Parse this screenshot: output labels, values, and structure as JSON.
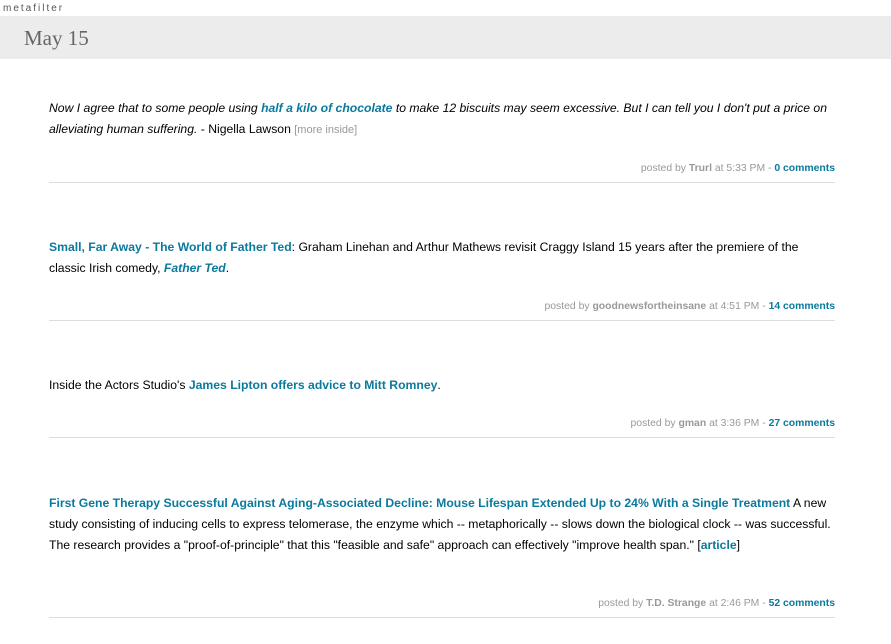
{
  "site": {
    "logo": "metafilter"
  },
  "date_header": "May 15",
  "posts": [
    {
      "text_before": "Now I agree that to some people using ",
      "link": "half a kilo of chocolate",
      "text_after": " to make 12 biscuits may seem excessive. But I can tell you I don't put a price on alleviating human suffering.",
      "attribution": " - Nigella Lawson ",
      "more_inside": "[more inside]",
      "posted_by_label": "posted by",
      "user": "Trurl",
      "time": "at 5:33 PM -",
      "comments": "0 comments"
    },
    {
      "link": "Small, Far Away - The World of Father Ted",
      "text_mid": ": Graham Linehan and Arthur Mathews revisit Craggy Island 15 years after the premiere of the classic Irish comedy, ",
      "link2": "Father Ted",
      "text_end": ".",
      "posted_by_label": "posted by",
      "user": "goodnewsfortheinsane",
      "time": "at 4:51 PM -",
      "comments": "14 comments"
    },
    {
      "text_before": "Inside the Actors Studio's ",
      "link": "James Lipton offers advice to Mitt Romney",
      "text_after": ".",
      "posted_by_label": "posted by",
      "user": "gman",
      "time": "at 3:36 PM -",
      "comments": "27 comments"
    },
    {
      "link": "First Gene Therapy Successful Against Aging-Associated Decline: Mouse Lifespan Extended Up to 24% With a Single Treatment",
      "text_mid": " A new study consisting of inducing cells to express telomerase, the enzyme which -- metaphorically -- slows down the biological clock -- was successful. The research provides a \"proof-of-principle\" that this \"feasible and safe\" approach can effectively \"improve health span.\" ",
      "bracket_open": "[",
      "link2": "article",
      "bracket_close": "]",
      "posted_by_label": "posted by",
      "user": "T.D. Strange",
      "time": "at 2:46 PM -",
      "comments": "52 comments"
    }
  ]
}
